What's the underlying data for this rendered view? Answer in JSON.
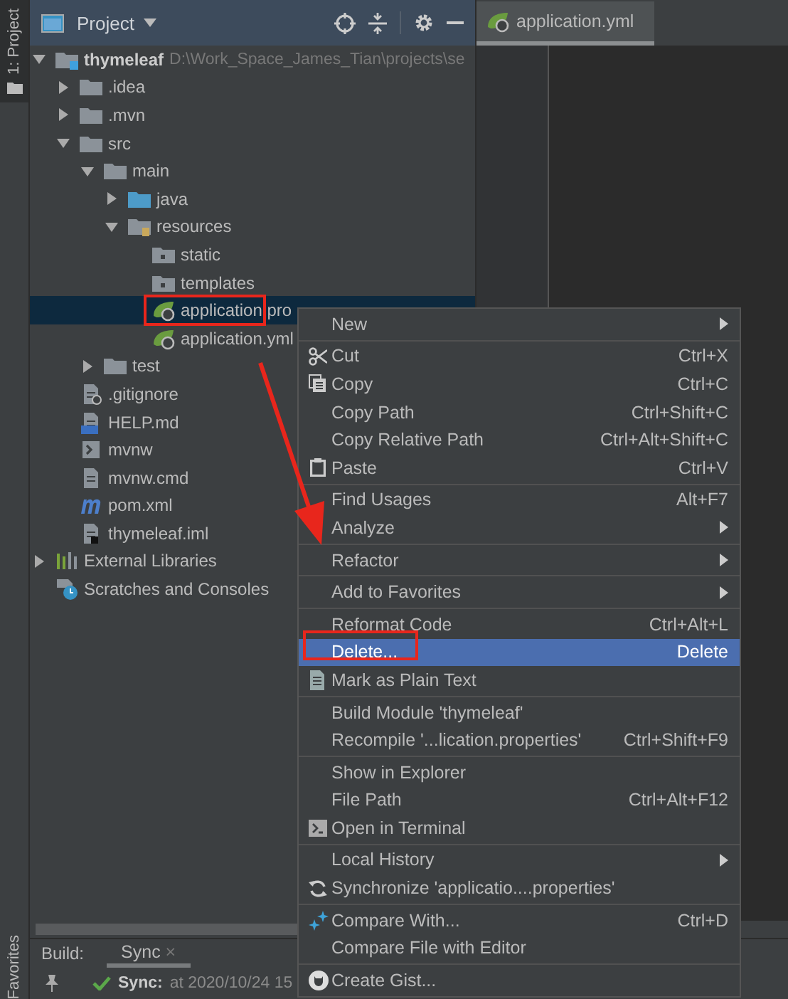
{
  "side_strip": {
    "project_button": {
      "label": "1: Project",
      "selected": true
    },
    "favorites_button": {
      "label": "Favorites"
    }
  },
  "project_panel": {
    "title": "Project",
    "tree": [
      {
        "label": "thymeleaf",
        "path": "D:\\Work_Space_James_Tian\\projects\\se",
        "kind": "module",
        "expanded": true,
        "selected": false,
        "children": [
          {
            "label": ".idea",
            "kind": "folder",
            "expanded": false,
            "selected": false
          },
          {
            "label": ".mvn",
            "kind": "folder",
            "expanded": false,
            "selected": false
          },
          {
            "label": "src",
            "kind": "folder",
            "expanded": true,
            "selected": false,
            "children": [
              {
                "label": "main",
                "kind": "folder",
                "expanded": true,
                "selected": false,
                "children": [
                  {
                    "label": "java",
                    "kind": "source-folder",
                    "expanded": false,
                    "selected": false
                  },
                  {
                    "label": "resources",
                    "kind": "resources-folder",
                    "expanded": true,
                    "selected": false,
                    "children": [
                      {
                        "label": "static",
                        "kind": "web-folder",
                        "selected": false
                      },
                      {
                        "label": "templates",
                        "kind": "web-folder",
                        "selected": false
                      },
                      {
                        "label": "application.pro",
                        "kind": "config-file",
                        "selected": true
                      },
                      {
                        "label": "application.yml",
                        "kind": "config-file",
                        "selected": false
                      }
                    ]
                  }
                ]
              },
              {
                "label": "test",
                "kind": "folder",
                "expanded": false,
                "selected": false
              }
            ]
          },
          {
            "label": ".gitignore",
            "kind": "ignore-file",
            "selected": false
          },
          {
            "label": "HELP.md",
            "kind": "md-file",
            "selected": false
          },
          {
            "label": "mvnw",
            "kind": "shell-file",
            "selected": false
          },
          {
            "label": "mvnw.cmd",
            "kind": "text-file",
            "selected": false
          },
          {
            "label": "pom.xml",
            "kind": "maven-file",
            "selected": false
          },
          {
            "label": "thymeleaf.iml",
            "kind": "iml-file",
            "selected": false
          }
        ]
      },
      {
        "label": "External Libraries",
        "kind": "libraries",
        "expanded": false,
        "selected": false
      },
      {
        "label": "Scratches and Consoles",
        "kind": "scratches",
        "selected": false
      }
    ]
  },
  "editor": {
    "tabs": [
      {
        "label": "application.yml",
        "selected": true
      }
    ]
  },
  "build_panel": {
    "label": "Build:",
    "tabs": [
      {
        "label": "Sync",
        "close": "×",
        "selected": true
      }
    ],
    "status": {
      "title": "Sync:",
      "text": "at 2020/10/24 15"
    }
  },
  "context_menu": {
    "groups": [
      [
        {
          "label": "New",
          "submenu": true,
          "selected": false
        }
      ],
      [
        {
          "label": "Cut",
          "shortcut": "Ctrl+X",
          "kind": "cut",
          "selected": false
        },
        {
          "label": "Copy",
          "shortcut": "Ctrl+C",
          "kind": "copy",
          "selected": false
        },
        {
          "label": "Copy Path",
          "shortcut": "Ctrl+Shift+C",
          "selected": false
        },
        {
          "label": "Copy Relative Path",
          "shortcut": "Ctrl+Alt+Shift+C",
          "selected": false
        },
        {
          "label": "Paste",
          "shortcut": "Ctrl+V",
          "kind": "paste",
          "selected": false
        }
      ],
      [
        {
          "label": "Find Usages",
          "shortcut": "Alt+F7",
          "selected": false
        },
        {
          "label": "Analyze",
          "submenu": true,
          "selected": false
        }
      ],
      [
        {
          "label": "Refactor",
          "submenu": true,
          "selected": false
        }
      ],
      [
        {
          "label": "Add to Favorites",
          "submenu": true,
          "selected": false
        }
      ],
      [
        {
          "label": "Reformat Code",
          "shortcut": "Ctrl+Alt+L",
          "selected": false
        },
        {
          "label": "Delete...",
          "shortcut": "Delete",
          "selected": true
        },
        {
          "label": "Mark as Plain Text",
          "kind": "text",
          "selected": false
        }
      ],
      [
        {
          "label": "Build Module 'thymeleaf'",
          "selected": false
        },
        {
          "label": "Recompile '...lication.properties'",
          "shortcut": "Ctrl+Shift+F9",
          "selected": false
        }
      ],
      [
        {
          "label": "Show in Explorer",
          "selected": false
        },
        {
          "label": "File Path",
          "shortcut": "Ctrl+Alt+F12",
          "selected": false
        },
        {
          "label": "Open in Terminal",
          "kind": "terminal",
          "selected": false
        }
      ],
      [
        {
          "label": "Local History",
          "submenu": true,
          "selected": false
        },
        {
          "label": "Synchronize 'applicatio....properties'",
          "kind": "sync",
          "selected": false
        }
      ],
      [
        {
          "label": "Compare With...",
          "shortcut": "Ctrl+D",
          "kind": "compare",
          "selected": false
        },
        {
          "label": "Compare File with Editor",
          "selected": false
        }
      ],
      [
        {
          "label": "Create Gist...",
          "kind": "gist",
          "selected": false
        }
      ]
    ]
  }
}
